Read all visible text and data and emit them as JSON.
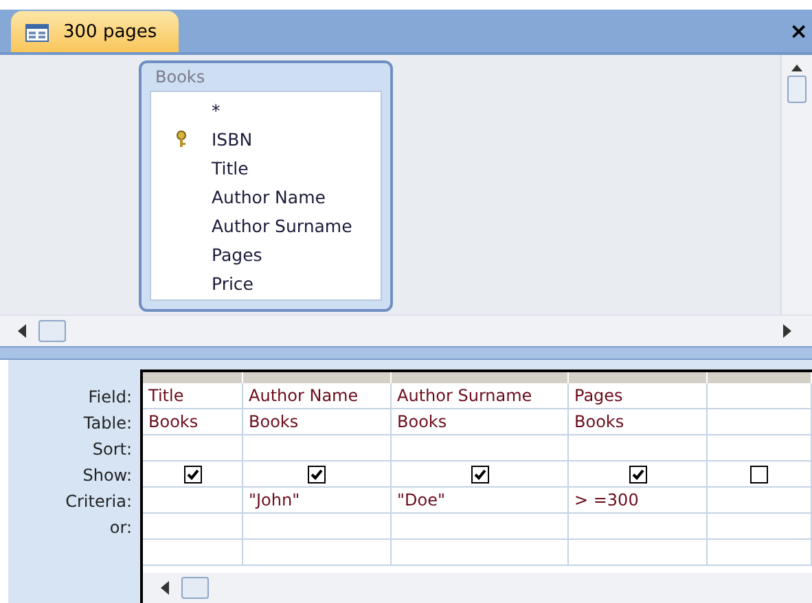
{
  "document_tab": {
    "title": "300 pages",
    "selected": true
  },
  "close_button": "×",
  "table_box": {
    "title": "Books",
    "fields": [
      {
        "name": "*",
        "primary_key": false
      },
      {
        "name": "ISBN",
        "primary_key": true
      },
      {
        "name": "Title",
        "primary_key": false
      },
      {
        "name": "Author Name",
        "primary_key": false
      },
      {
        "name": "Author Surname",
        "primary_key": false
      },
      {
        "name": "Pages",
        "primary_key": false
      },
      {
        "name": "Price",
        "primary_key": false
      }
    ]
  },
  "grid": {
    "row_labels": [
      "Field:",
      "Table:",
      "Sort:",
      "Show:",
      "Criteria:",
      "or:"
    ],
    "columns": [
      {
        "field": "Title",
        "table": "Books",
        "show": true
      },
      {
        "field": "Author Name",
        "table": "Books",
        "show": true,
        "criteria": "\"John\""
      },
      {
        "field": "Author Surname",
        "table": "Books",
        "show": true,
        "criteria": "\"Doe\""
      },
      {
        "field": "Pages",
        "table": "Books",
        "show": true,
        "criteria": "> =300"
      },
      {
        "show": false
      }
    ]
  }
}
